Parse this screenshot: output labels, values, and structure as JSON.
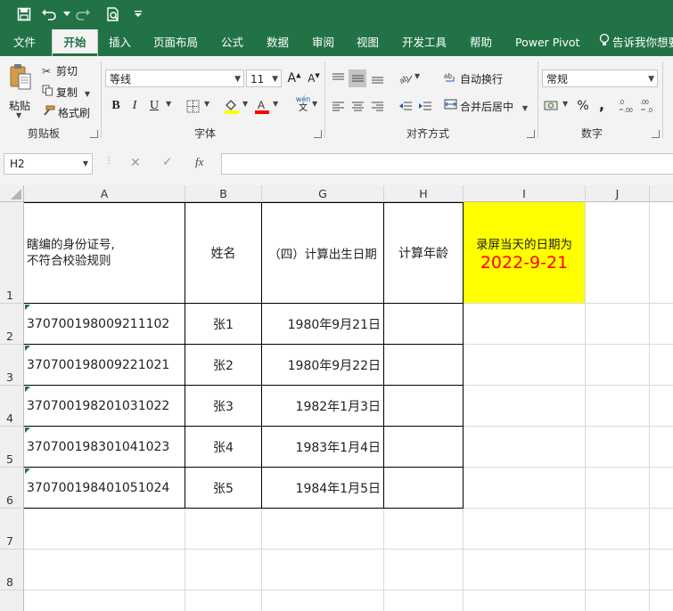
{
  "colors": {
    "brand": "#217346",
    "highlight": "#ffff00",
    "date_text": "#ff0000"
  },
  "quick_access": {
    "icons": [
      "save-icon",
      "undo-icon",
      "redo-icon",
      "print-preview-icon",
      "customize-icon"
    ]
  },
  "tabs": [
    {
      "label": "文件",
      "active": false
    },
    {
      "label": "开始",
      "active": true
    },
    {
      "label": "插入",
      "active": false
    },
    {
      "label": "页面布局",
      "active": false
    },
    {
      "label": "公式",
      "active": false
    },
    {
      "label": "数据",
      "active": false
    },
    {
      "label": "审阅",
      "active": false
    },
    {
      "label": "视图",
      "active": false
    },
    {
      "label": "开发工具",
      "active": false
    },
    {
      "label": "帮助",
      "active": false
    },
    {
      "label": "Power Pivot",
      "active": false
    }
  ],
  "tell_me": "告诉我你想要",
  "ribbon": {
    "clipboard": {
      "paste": "粘贴",
      "cut": "剪切",
      "copy": "复制",
      "format_painter": "格式刷",
      "label": "剪贴板"
    },
    "font": {
      "name": "等线",
      "size": "11",
      "label": "字体",
      "bold": "B",
      "italic": "I",
      "underline": "U",
      "phonetic_top": "wén",
      "phonetic_bottom": "文"
    },
    "alignment": {
      "wrap_text": "自动换行",
      "merge_center": "合并后居中",
      "label": "对齐方式"
    },
    "number": {
      "format": "常规",
      "label": "数字",
      "percent": "%",
      "comma": ","
    }
  },
  "formula_bar": {
    "cell_ref": "H2",
    "content": "",
    "fx": "fx"
  },
  "sheet": {
    "columns": [
      "A",
      "B",
      "G",
      "H",
      "I",
      "J"
    ],
    "rows": [
      "1",
      "2",
      "3",
      "4",
      "5",
      "6",
      "7",
      "8"
    ],
    "header": {
      "id_line1": "瞎编的身份证号,",
      "id_line2": "不符合校验规则",
      "name": "姓名",
      "birth": "（四）计算出生日期",
      "age": "计算年龄",
      "record_label": "录屏当天的日期为",
      "record_date": "2022-9-21"
    },
    "data": [
      {
        "id": "370700198009211102",
        "name": "张1",
        "birth": "1980年9月21日",
        "age": ""
      },
      {
        "id": "370700198009221021",
        "name": "张2",
        "birth": "1980年9月22日",
        "age": ""
      },
      {
        "id": "370700198201031022",
        "name": "张3",
        "birth": "1982年1月3日",
        "age": ""
      },
      {
        "id": "370700198301041023",
        "name": "张4",
        "birth": "1983年1月4日",
        "age": ""
      },
      {
        "id": "370700198401051024",
        "name": "张5",
        "birth": "1984年1月5日",
        "age": ""
      }
    ]
  }
}
